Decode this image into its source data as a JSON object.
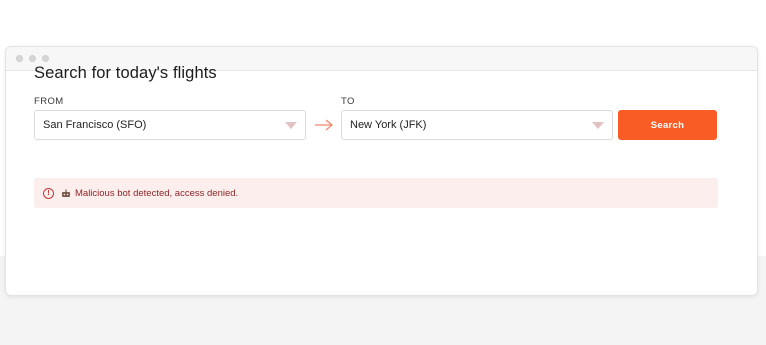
{
  "form": {
    "heading": "Search for today's flights",
    "from": {
      "label": "FROM",
      "value": "San Francisco (SFO)"
    },
    "to": {
      "label": "TO",
      "value": "New York (JFK)"
    },
    "search_label": "Search"
  },
  "error": {
    "message": "Malicious bot detected, access denied.",
    "icon": "exclamation-circle-icon",
    "prefix_icon": "bot-icon"
  },
  "colors": {
    "accent": "#fa5c26",
    "error_bg": "#fdeeee",
    "error_text": "#8b2626"
  }
}
